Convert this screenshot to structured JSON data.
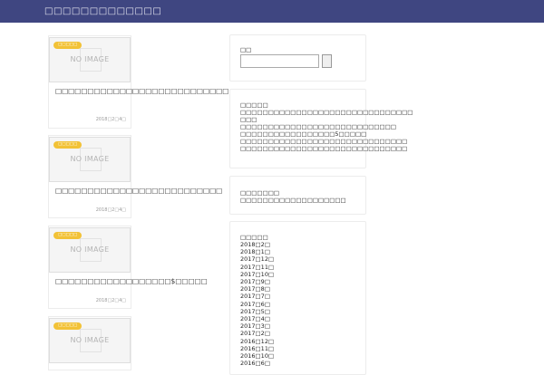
{
  "header": {
    "site_title": "□□□□□□□□□□□□□"
  },
  "cards": [
    {
      "badge": "□□□□□",
      "noimage": "NO IMAGE",
      "title": "□□□□□□□□□□□□□□□□□□□□□□□□□□□",
      "date": "2018□2□4□"
    },
    {
      "badge": "□□□□□",
      "noimage": "NO IMAGE",
      "title": "□□□□□□□□□□□□□□□□□□□□□□□□□□",
      "date": "2018□2□4□"
    },
    {
      "badge": "□□□□□",
      "noimage": "NO IMAGE",
      "title": "□□□□□□□□□□□□□□□□□□$□□□□□",
      "date": "2018□2□4□"
    },
    {
      "badge": "□□□□□",
      "noimage": "NO IMAGE"
    }
  ],
  "sidebar": {
    "search": {
      "title": "□□"
    },
    "about": {
      "title": "□□□□□",
      "lines": [
        "□□□□□□□□□□□□□□□□□□□□□□□□□□□□□□□",
        "□□□",
        "□□□□□□□□□□□□□□□□□□□□□□□□□□□□",
        "□□□□□□□□□□□□□□□□□5□□□□□",
        "□□□□□□□□□□□□□□□□□□□□□□□□□□□□□□",
        "□□□□□□□□□□□□□□□□□□□□□□□□□□□□□□"
      ]
    },
    "comments": {
      "title": "□□□□□□□",
      "text": "□□□□□□□□□□□□□□□□□□□"
    },
    "archive": {
      "title": "□□□□□",
      "items": [
        "2018□2□",
        "2018□1□",
        "2017□12□",
        "2017□11□",
        "2017□10□",
        "2017□9□",
        "2017□8□",
        "2017□7□",
        "2017□6□",
        "2017□5□",
        "2017□4□",
        "2017□3□",
        "2017□2□",
        "2016□12□",
        "2016□11□",
        "2016□10□",
        "2016□6□"
      ]
    }
  }
}
